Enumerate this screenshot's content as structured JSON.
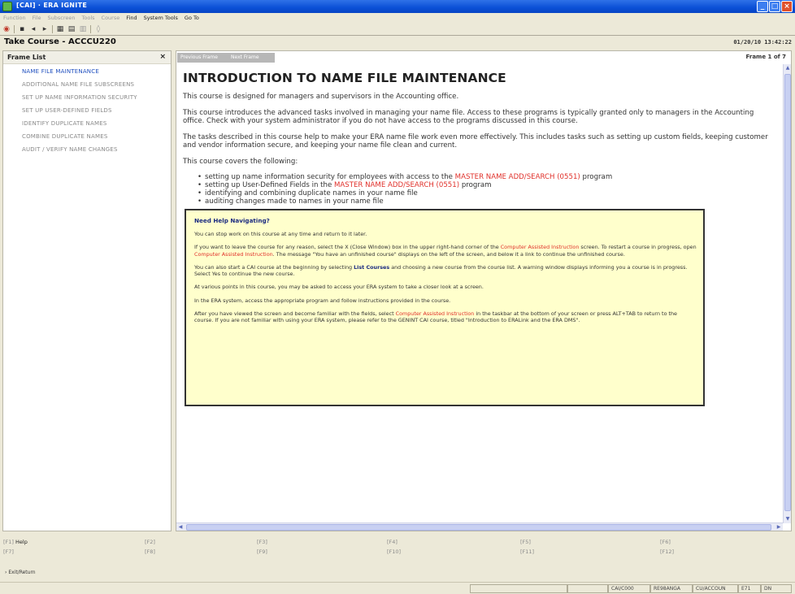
{
  "window": {
    "title": "[CAI] · ERA IGNITE",
    "minimize": "_",
    "maximize": "□",
    "close": "×"
  },
  "menu": [
    {
      "label": "Function",
      "active": false
    },
    {
      "label": "File",
      "active": false
    },
    {
      "label": "Subscreen",
      "active": false
    },
    {
      "label": "Tools",
      "active": false
    },
    {
      "label": "Course",
      "active": false
    },
    {
      "label": "Find",
      "active": true
    },
    {
      "label": "System Tools",
      "active": true
    },
    {
      "label": "Go To",
      "active": true
    }
  ],
  "course": {
    "title": "Take Course - ACCCU220",
    "datetime": "01/20/10 13:42:22"
  },
  "frame_list": {
    "title": "Frame List",
    "close": "×",
    "items": [
      {
        "label": "NAME FILE MAINTENANCE",
        "active": true
      },
      {
        "label": "ADDITIONAL NAME FILE SUBSCREENS",
        "active": false
      },
      {
        "label": "SET UP NAME INFORMATION SECURITY",
        "active": false
      },
      {
        "label": "SET UP USER-DEFINED FIELDS",
        "active": false
      },
      {
        "label": "IDENTIFY DUPLICATE NAMES",
        "active": false
      },
      {
        "label": "COMBINE DUPLICATE NAMES",
        "active": false
      },
      {
        "label": "AUDIT / VERIFY NAME CHANGES",
        "active": false
      }
    ]
  },
  "nav": {
    "prev": "Previous Frame",
    "next": "Next Frame",
    "frame_counter": "Frame 1 of 7"
  },
  "content": {
    "heading": "INTRODUCTION TO NAME FILE MAINTENANCE",
    "para1": "This course is designed for managers and supervisors in the Accounting office.",
    "para2": "This course introduces the advanced tasks involved in managing your name file.  Access to these programs is typically granted only to managers in the Accounting office.  Check with your system administrator if you do not have access to the programs discussed in this course.",
    "para3": "The tasks described in this course help to make your ERA name file work even more effectively.  This includes tasks such as setting up custom fields, keeping customer and vendor information secure, and keeping your name file clean and current.",
    "para4": "This course covers the following:",
    "bullet1_a": "setting up name information security for employees with access to the ",
    "bullet1_hl": "MASTER NAME ADD/SEARCH (0551)",
    "bullet1_b": " program",
    "bullet2_a": "setting up User-Defined Fields in the ",
    "bullet2_hl": "MASTER NAME ADD/SEARCH (0551)",
    "bullet2_b": " program",
    "bullet3": "identifying and combining duplicate names in your name file",
    "bullet4": "auditing changes made to names in your name file"
  },
  "help": {
    "title": "Need Help Navigating?",
    "p1": "You can stop work on this course at any time and return to it later.",
    "p2_a": "If you want to leave the course for any reason, select the X (Close Window) box in the upper right-hand corner of the ",
    "p2_hl1": "Computer Assisted Instruction",
    "p2_b": " screen. To restart a course in progress, open ",
    "p2_hl2": "Computer Assisted Instruction",
    "p2_c": ". The message \"You have an unfinished course\" displays on the left of the screen, and below it a link to continue the unfinished course.",
    "p3_a": "You can also start a CAI course at the beginning by selecting ",
    "p3_bold": "List Courses",
    "p3_b": " and choosing a new course from the course list. A warning window displays informing you a course is in progress. Select Yes to continue the new course.",
    "p4": "At various points in this course, you may be asked to access your ERA system to take a closer look at a screen.",
    "p5": "In the ERA system, access the appropriate program and follow instructions provided in the course.",
    "p6_a": "After you have viewed the screen and become familiar with the fields, select ",
    "p6_hl": "Computer Assisted Instruction",
    "p6_b": " in the taskbar at the bottom of your screen or press ALT+TAB to return to the course. If you are not familiar with using your ERA system, please refer to the GENINT CAI course, titled \"Introduction to ERALink and the ERA DMS\"."
  },
  "fkeys": {
    "f1": "[F1]",
    "f1_label": "Help",
    "f2": "[F2]",
    "f3": "[F3]",
    "f4": "[F4]",
    "f5": "[F5]",
    "f6": "[F6]",
    "f7": "[F7]",
    "f8": "[F8]",
    "f9": "[F9]",
    "f10": "[F10]",
    "f11": "[F11]",
    "f12": "[F12]"
  },
  "exit_label": "Exit/Return",
  "status": {
    "f1": "CAI/C000",
    "f2": "RE98ANGA",
    "f3": "CU/ACCOUN",
    "f4": "E71",
    "f5": "DN"
  },
  "colors": {
    "highlight": "#e0302a",
    "active_link": "#1f4fbf",
    "help_bg": "#ffffcc"
  }
}
